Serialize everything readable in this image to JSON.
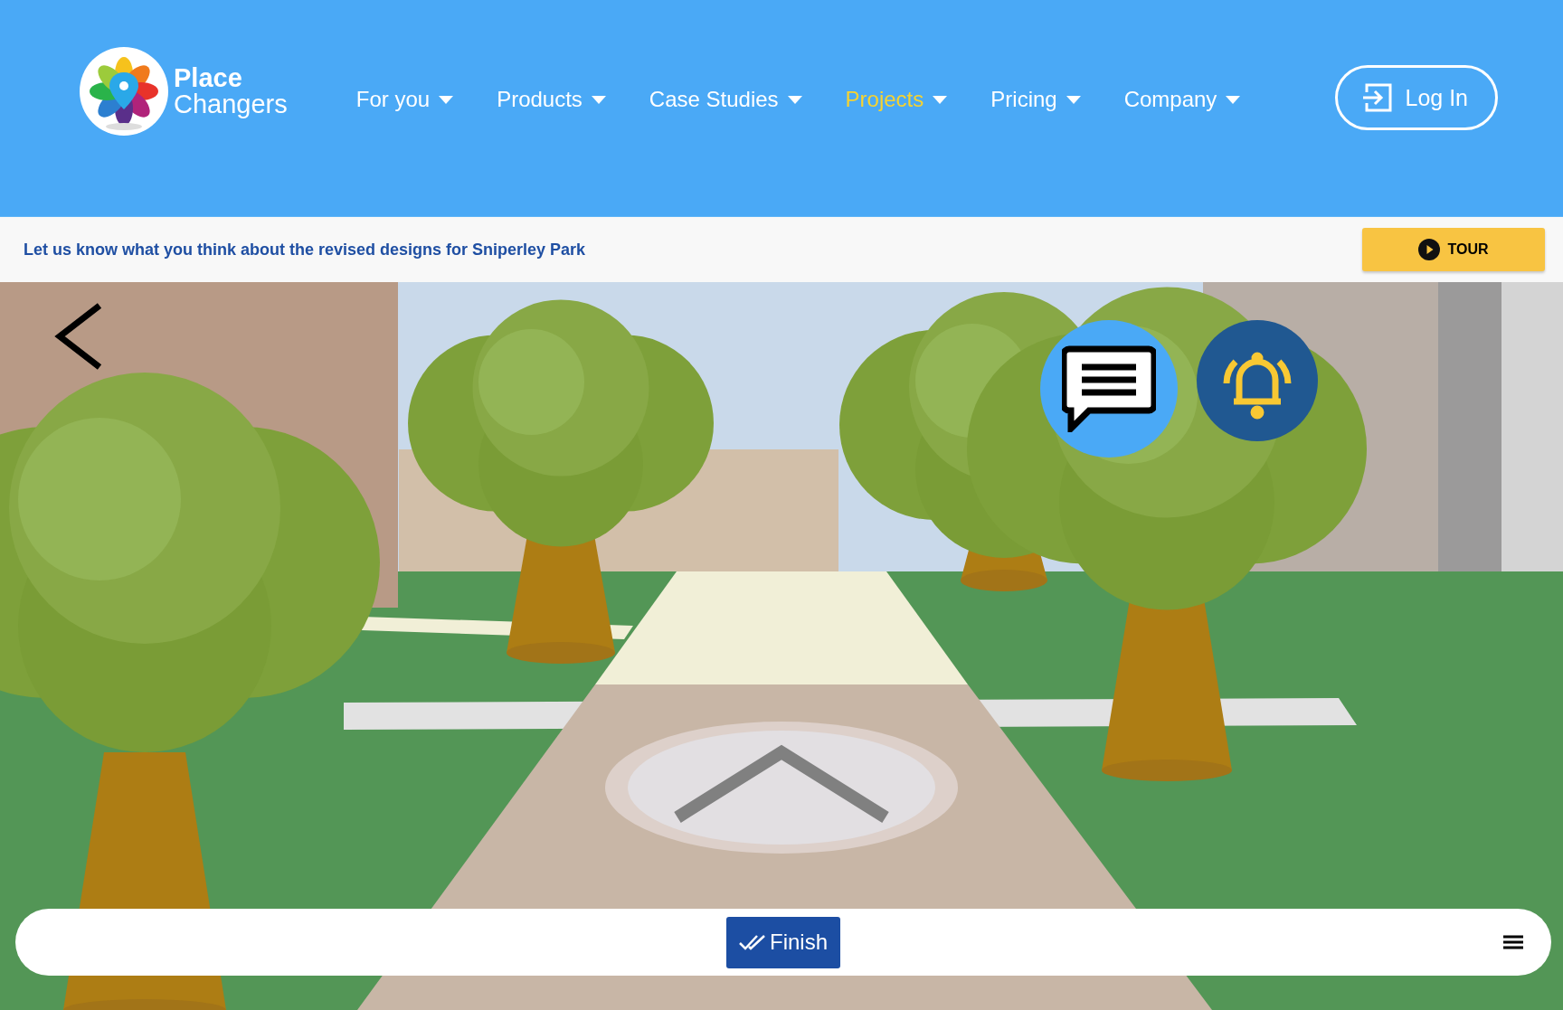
{
  "logo": {
    "line_1": "Place",
    "line_2": "Changers"
  },
  "nav": [
    {
      "label": "For you",
      "selected": false
    },
    {
      "label": "Products",
      "selected": false
    },
    {
      "label": "Case Studies",
      "selected": false
    },
    {
      "label": "Projects",
      "selected": true
    },
    {
      "label": "Pricing",
      "selected": false
    },
    {
      "label": "Company",
      "selected": false
    }
  ],
  "login": {
    "label": "Log In"
  },
  "banner": {
    "message": "Let us know what you think about the revised designs for Sniperley Park",
    "tour_button": "TOUR"
  },
  "bottom_bar": {
    "finish_button": "Finish"
  }
}
